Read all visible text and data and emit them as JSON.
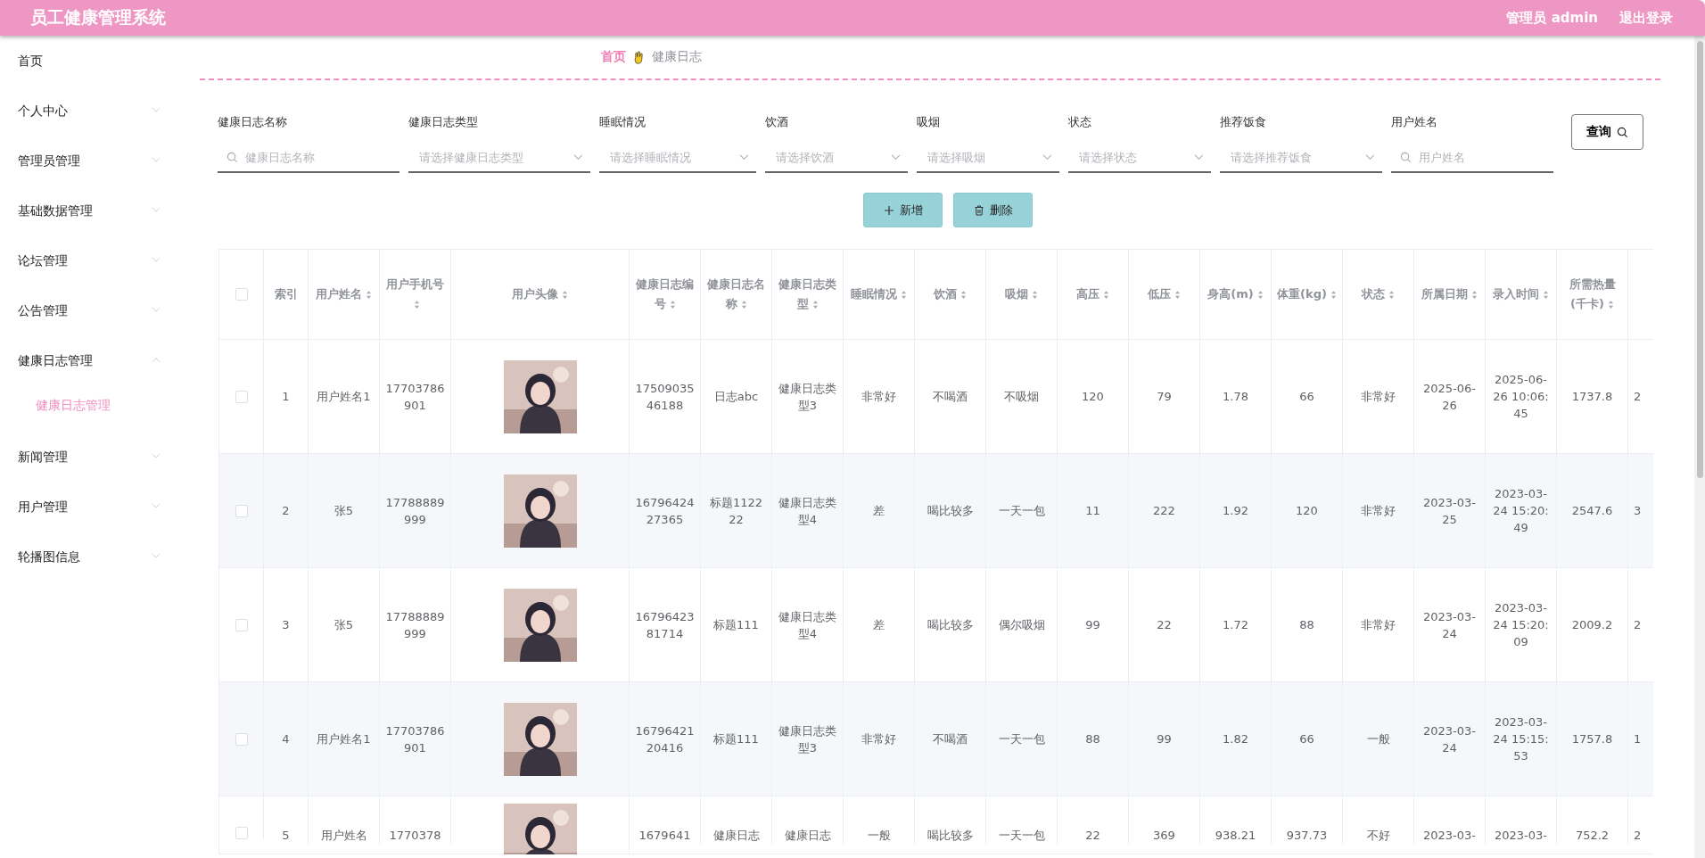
{
  "header": {
    "title": "员工健康管理系统",
    "user": "管理员 admin",
    "logout": "退出登录"
  },
  "sidebar": {
    "items": [
      {
        "kind": "link",
        "label": "首页"
      },
      {
        "kind": "menu",
        "label": "个人中心",
        "expanded": false
      },
      {
        "kind": "menu",
        "label": "管理员管理",
        "expanded": false
      },
      {
        "kind": "menu",
        "label": "基础数据管理",
        "expanded": false
      },
      {
        "kind": "menu",
        "label": "论坛管理",
        "expanded": false
      },
      {
        "kind": "menu",
        "label": "公告管理",
        "expanded": false
      },
      {
        "kind": "menu",
        "label": "健康日志管理",
        "expanded": true,
        "children": [
          {
            "label": "健康日志管理",
            "selected": true
          }
        ]
      },
      {
        "kind": "menu",
        "label": "新闻管理",
        "expanded": false
      },
      {
        "kind": "menu",
        "label": "用户管理",
        "expanded": false
      },
      {
        "kind": "menu",
        "label": "轮播图信息",
        "expanded": false
      }
    ]
  },
  "breadcrumb": [
    {
      "label": "首页",
      "current": false
    },
    {
      "label": "健康日志",
      "current": true
    }
  ],
  "filters": [
    {
      "kind": "search",
      "label": "健康日志名称",
      "placeholder": "健康日志名称"
    },
    {
      "kind": "select",
      "label": "健康日志类型",
      "placeholder": "请选择健康日志类型"
    },
    {
      "kind": "select",
      "label": "睡眠情况",
      "placeholder": "请选择睡眠情况"
    },
    {
      "kind": "select",
      "label": "饮酒",
      "placeholder": "请选择饮酒"
    },
    {
      "kind": "select",
      "label": "吸烟",
      "placeholder": "请选择吸烟"
    },
    {
      "kind": "select",
      "label": "状态",
      "placeholder": "请选择状态"
    },
    {
      "kind": "select",
      "label": "推荐饭食",
      "placeholder": "请选择推荐饭食"
    },
    {
      "kind": "search",
      "label": "用户姓名",
      "placeholder": "用户姓名"
    }
  ],
  "query_button": "查询",
  "actions": [
    {
      "kind": "add",
      "label": "新增"
    },
    {
      "kind": "delete",
      "label": "删除"
    }
  ],
  "table": {
    "columns": [
      {
        "kind": "checkbox",
        "checked": false
      },
      {
        "kind": "plain",
        "label": "索引"
      },
      {
        "kind": "sortable",
        "label": "用户姓名"
      },
      {
        "kind": "sortable",
        "label": "用户手机号"
      },
      {
        "kind": "sortable",
        "label": "用户头像"
      },
      {
        "kind": "sortable",
        "label": "健康日志编号"
      },
      {
        "kind": "sortable",
        "label": "健康日志名称"
      },
      {
        "kind": "sortable",
        "label": "健康日志类型"
      },
      {
        "kind": "sortable",
        "label": "睡眠情况"
      },
      {
        "kind": "sortable",
        "label": "饮酒"
      },
      {
        "kind": "sortable",
        "label": "吸烟"
      },
      {
        "kind": "sortable",
        "label": "高压"
      },
      {
        "kind": "sortable",
        "label": "低压"
      },
      {
        "kind": "sortable",
        "label": "身高(m)"
      },
      {
        "kind": "sortable",
        "label": "体重(kg)"
      },
      {
        "kind": "sortable",
        "label": "状态"
      },
      {
        "kind": "sortable",
        "label": "所属日期"
      },
      {
        "kind": "sortable",
        "label": "录入时间"
      },
      {
        "kind": "sortable",
        "label": "所需热量(千卡)"
      },
      {
        "kind": "cut"
      }
    ],
    "rows": [
      {
        "cells": [
          {
            "kind": "checkbox",
            "checked": false
          },
          "1",
          "用户姓名1",
          "17703786901",
          {
            "kind": "picture"
          },
          "1750903546188",
          "日志abc",
          "健康日志类型3",
          "非常好",
          "不喝酒",
          "不吸烟",
          "120",
          "79",
          "1.78",
          "66",
          "非常好",
          "2025-06-26",
          "2025-06-26 10:06:45",
          "1737.8",
          "2"
        ]
      },
      {
        "cells": [
          {
            "kind": "checkbox",
            "checked": false
          },
          "2",
          "张5",
          "17788889999",
          {
            "kind": "picture"
          },
          "1679642427365",
          "标题112222",
          "健康日志类型4",
          "差",
          "喝比较多",
          "一天一包",
          "11",
          "222",
          "1.92",
          "120",
          "非常好",
          "2023-03-25",
          "2023-03-24 15:20:49",
          "2547.6",
          "3"
        ]
      },
      {
        "cells": [
          {
            "kind": "checkbox",
            "checked": false
          },
          "3",
          "张5",
          "17788889999",
          {
            "kind": "picture"
          },
          "1679642381714",
          "标题111",
          "健康日志类型4",
          "差",
          "喝比较多",
          "偶尔吸烟",
          "99",
          "22",
          "1.72",
          "88",
          "非常好",
          "2023-03-24",
          "2023-03-24 15:20:09",
          "2009.2",
          "2"
        ]
      },
      {
        "cells": [
          {
            "kind": "checkbox",
            "checked": false
          },
          "4",
          "用户姓名1",
          "17703786901",
          {
            "kind": "picture"
          },
          "1679642120416",
          "标题111",
          "健康日志类型3",
          "非常好",
          "不喝酒",
          "一天一包",
          "88",
          "99",
          "1.82",
          "66",
          "一般",
          "2023-03-24",
          "2023-03-24 15:15:53",
          "1757.8",
          "1"
        ]
      },
      {
        "cells": [
          {
            "kind": "checkbox",
            "checked": false
          },
          "5",
          "用户姓名",
          "1770378",
          {
            "kind": "picture"
          },
          "1679641",
          "健康日志",
          "健康日志",
          "一般",
          "喝比较多",
          "一天一包",
          "22",
          "369",
          "938.21",
          "937.73",
          "不好",
          "2023-03-",
          "2023-03-",
          "752.2",
          "2"
        ]
      }
    ]
  }
}
